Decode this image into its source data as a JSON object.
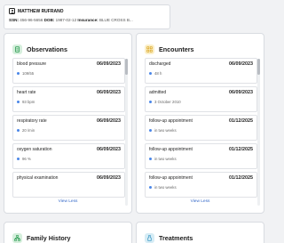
{
  "patient": {
    "name": "MATTHEW RUFRANO",
    "ssn_label": "SSN:",
    "ssn": "456-96-5656",
    "dob_label": "DOB:",
    "dob": "1987-02-12",
    "insurance_label": "Insurance:",
    "insurance": "BLUE CROSS B..."
  },
  "observations": {
    "title": "Observations",
    "items": [
      {
        "name": "blood pressure",
        "date": "06/09/2023",
        "value": "109/55"
      },
      {
        "name": "heart rate",
        "date": "06/09/2023",
        "value": "93 bpm"
      },
      {
        "name": "respiratory rate",
        "date": "06/09/2023",
        "value": "20 /min"
      },
      {
        "name": "oxygen saturation",
        "date": "06/09/2023",
        "value": "96 %"
      },
      {
        "name": "physical examination",
        "date": "06/09/2023",
        "value": ""
      }
    ],
    "view_less": "View Less"
  },
  "encounters": {
    "title": "Encounters",
    "items": [
      {
        "name": "discharged",
        "date": "06/09/2023",
        "value": "48 h"
      },
      {
        "name": "admitted",
        "date": "06/09/2023",
        "value": "3 October 2010"
      },
      {
        "name": "follow-up appointment",
        "date": "01/12/2025",
        "value": "in two weeks"
      },
      {
        "name": "follow-up appointment",
        "date": "01/12/2025",
        "value": "in two weeks"
      },
      {
        "name": "follow-up appointment",
        "date": "01/12/2025",
        "value": "in two weeks"
      }
    ],
    "view_less": "View Less"
  },
  "family_history": {
    "title": "Family History"
  },
  "treatments": {
    "title": "Treatments"
  },
  "colors": {
    "link": "#3569c8",
    "dot": "#4a86e8",
    "obs_icon": "#2f9d55",
    "enc_icon": "#d9a21b",
    "fam_icon": "#2f9d55",
    "tre_icon": "#2a8fbf"
  }
}
